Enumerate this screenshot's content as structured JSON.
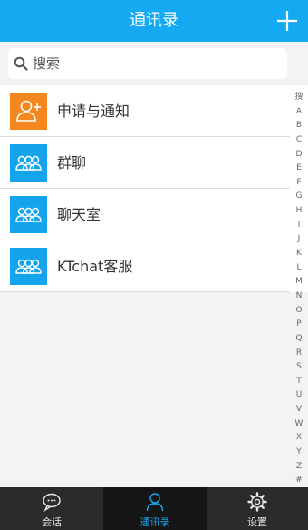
{
  "header": {
    "title": "通讯录"
  },
  "search": {
    "placeholder": "搜索"
  },
  "contacts": [
    {
      "label": "申请与通知",
      "icon": "add-user-icon",
      "color": "#f5871f"
    },
    {
      "label": "群聊",
      "icon": "group-icon",
      "color": "#14a4ee"
    },
    {
      "label": "聊天室",
      "icon": "group-icon",
      "color": "#14a4ee"
    },
    {
      "label": "KTchat客服",
      "icon": "group-icon",
      "color": "#14a4ee"
    }
  ],
  "index": [
    "搜",
    "A",
    "B",
    "C",
    "D",
    "E",
    "F",
    "G",
    "H",
    "I",
    "J",
    "K",
    "L",
    "M",
    "N",
    "O",
    "P",
    "Q",
    "R",
    "S",
    "T",
    "U",
    "V",
    "W",
    "X",
    "Y",
    "Z",
    "#"
  ],
  "tabs": [
    {
      "label": "会话",
      "icon": "chat-icon",
      "active": false
    },
    {
      "label": "通讯录",
      "icon": "person-icon",
      "active": true
    },
    {
      "label": "设置",
      "icon": "gear-icon",
      "active": false
    }
  ],
  "colors": {
    "accent": "#14a9f1",
    "request_orange": "#f5871f",
    "group_blue": "#14a4ee",
    "tab_active": "#19a7ee"
  }
}
